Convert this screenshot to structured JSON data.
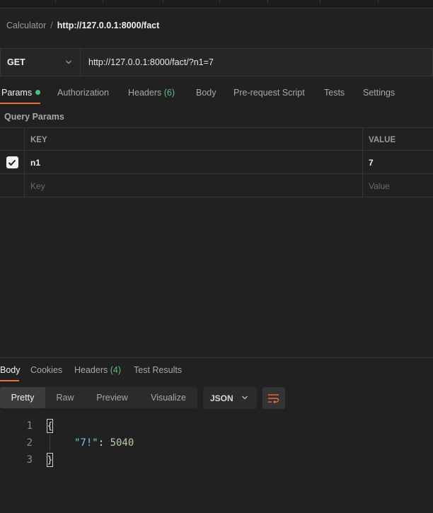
{
  "breadcrumb": {
    "parent": "Calculator",
    "separator": "/",
    "current": "http://127.0.0.1:8000/fact"
  },
  "request": {
    "method": "GET",
    "url": "http://127.0.0.1:8000/fact/?n1=7"
  },
  "request_tabs": {
    "params": "Params",
    "authorization": "Authorization",
    "headers": "Headers",
    "headers_count": "(6)",
    "body": "Body",
    "pre_request": "Pre-request Script",
    "tests": "Tests",
    "settings": "Settings"
  },
  "query_params": {
    "title": "Query Params",
    "col_key": "KEY",
    "col_value": "VALUE",
    "rows": [
      {
        "checked": true,
        "key": "n1",
        "value": "7"
      }
    ],
    "placeholder_key": "Key",
    "placeholder_value": "Value"
  },
  "response_tabs": {
    "body": "Body",
    "cookies": "Cookies",
    "headers": "Headers",
    "headers_count": "(4)",
    "test_results": "Test Results"
  },
  "view_modes": {
    "pretty": "Pretty",
    "raw": "Raw",
    "preview": "Preview",
    "visualize": "Visualize"
  },
  "format": "JSON",
  "response_body": {
    "line_numbers": [
      "1",
      "2",
      "3"
    ],
    "open_brace": "{",
    "close_brace": "}",
    "key": "\"7!\"",
    "colon": ": ",
    "value": "5040"
  },
  "colors": {
    "accent": "#f26b3a",
    "success": "#4fc07a",
    "json_key": "#7ec4e8",
    "json_number": "#b5cea8"
  },
  "icons": {
    "method_dropdown": "chevron-down-icon",
    "check": "check-icon",
    "wrap": "wrap-lines-icon"
  }
}
